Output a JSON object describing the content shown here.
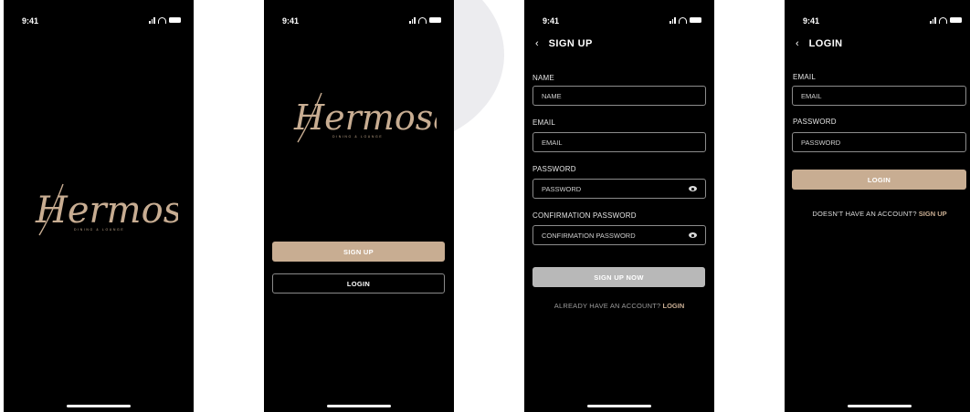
{
  "status": {
    "time": "9:41"
  },
  "brand": {
    "name": "Hermosa",
    "tagline": "DINING & LOUNGE"
  },
  "welcome": {
    "signup_label": "SIGN UP",
    "login_label": "LOGIN"
  },
  "signup": {
    "title": "SIGN UP",
    "name_label": "NAME",
    "name_placeholder": "NAME",
    "email_label": "EMAIL",
    "email_placeholder": "EMAIL",
    "password_label": "PASSWORD",
    "password_placeholder": "PASSWORD",
    "confirm_label": "CONFIRMATION PASSWORD",
    "confirm_placeholder": "CONFIRMATION PASSWORD",
    "submit_label": "SIGN UP NOW",
    "footer_prompt": "ALREADY HAVE AN ACCOUNT?",
    "footer_link": "LOGIN"
  },
  "login": {
    "title": "LOGIN",
    "email_label": "EMAIL",
    "email_placeholder": "EMAIL",
    "password_label": "PASSWORD",
    "password_placeholder": "PASSWORD",
    "submit_label": "LOGIN",
    "footer_prompt": "DOESN'T HAVE AN ACCOUNT?",
    "footer_link": "SIGN UP"
  },
  "colors": {
    "accent": "#c8ad92",
    "background": "#000000",
    "disabled": "#b8b8b8"
  },
  "icons": [
    "signal-icon",
    "wifi-icon",
    "battery-icon",
    "back-chevron-icon",
    "eye-icon"
  ]
}
